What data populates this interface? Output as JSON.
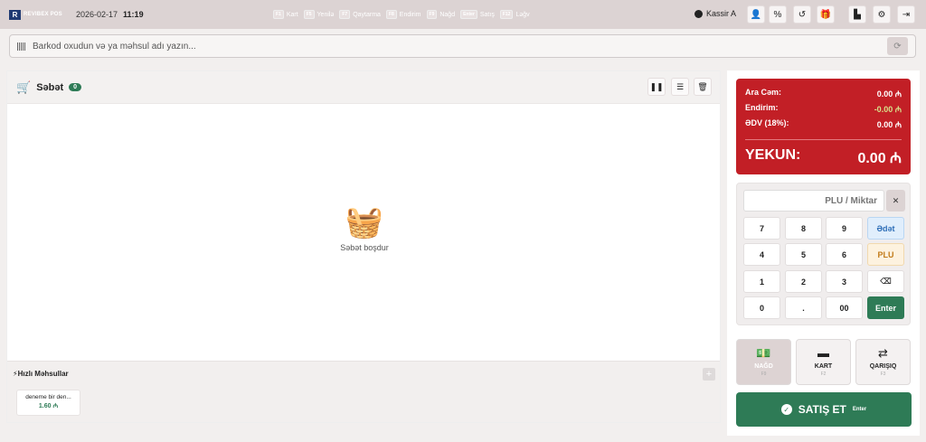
{
  "topbar": {
    "logo_mark": "R",
    "logo_text": "REVIBEX POS",
    "date": "2026-02-17",
    "time": "11:19",
    "shortcuts": [
      {
        "key": "F1",
        "label": "Kart"
      },
      {
        "key": "F5",
        "label": "Yenilə"
      },
      {
        "key": "F7",
        "label": "Qaytarma"
      },
      {
        "key": "F8",
        "label": "Endirim"
      },
      {
        "key": "F9",
        "label": "Nağd"
      },
      {
        "key": "Enter",
        "label": "Satış"
      },
      {
        "key": "F12",
        "label": "Ləğv"
      }
    ],
    "cashier": "Kassir A",
    "icons": [
      "user-icon",
      "percent-icon",
      "undo-icon",
      "gift-icon",
      "chart-icon",
      "gear-icon",
      "logout-icon"
    ]
  },
  "search": {
    "placeholder": "Barkod oxudun və ya məhsul adı yazın..."
  },
  "cart": {
    "title": "Səbət",
    "count": "0",
    "empty_text": "Səbət boşdur",
    "actions": [
      "pause-icon",
      "list-icon",
      "trash-icon"
    ]
  },
  "quick": {
    "title": "Hızlı Məhsullar",
    "products": [
      {
        "name": "deneme bir den...",
        "price": "1.60 ₼"
      }
    ]
  },
  "summary": {
    "subtotal_label": "Ara Cəm:",
    "subtotal_value": "0.00 ₼",
    "discount_label": "Endirim:",
    "discount_value": "-0.00 ₼",
    "vat_label": "ƏDV (18%):",
    "vat_value": "0.00 ₼",
    "total_label": "YEKUN:",
    "total_value": "0.00 ₼"
  },
  "keypad": {
    "placeholder": "PLU / Miktar",
    "clear": "✕",
    "keys": [
      "7",
      "8",
      "9",
      "Ədət",
      "4",
      "5",
      "6",
      "PLU",
      "1",
      "2",
      "3",
      "⌫",
      "0",
      ".",
      "00",
      "Enter"
    ]
  },
  "payment": [
    {
      "label": "NAĞD",
      "key": "F9",
      "icon": "cash-icon"
    },
    {
      "label": "KART",
      "key": "F2",
      "icon": "card-icon"
    },
    {
      "label": "QARIŞIQ",
      "key": "F3",
      "icon": "mixed-icon"
    }
  ],
  "sale_button": {
    "label": "SATIŞ ET",
    "key": "Enter"
  },
  "colors": {
    "topbar": "#dcd3d3",
    "accent_green": "#2e7b56",
    "summary_red": "#c21f26"
  }
}
